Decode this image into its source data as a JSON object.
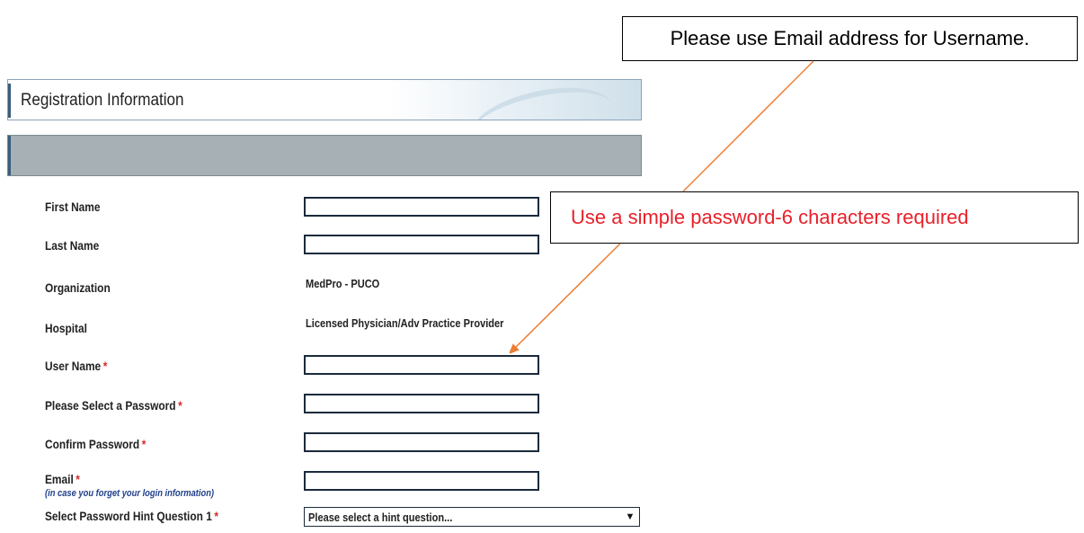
{
  "callouts": {
    "email_note": "Please use Email address for Username.",
    "password_note": "Use a simple password-6 characters required"
  },
  "header": {
    "title": "Registration Information"
  },
  "form": {
    "first_name": {
      "label": "First Name",
      "value": ""
    },
    "last_name": {
      "label": "Last Name",
      "value": ""
    },
    "organization": {
      "label": "Organization",
      "value": "MedPro - PUCO"
    },
    "hospital": {
      "label": "Hospital",
      "value": "Licensed Physician/Adv Practice Provider"
    },
    "user_name": {
      "label": "User Name",
      "value": ""
    },
    "password": {
      "label": "Please Select a Password",
      "value": ""
    },
    "confirm_password": {
      "label": "Confirm Password",
      "value": ""
    },
    "email": {
      "label": "Email",
      "note": "(in case you forget your login information)",
      "value": ""
    },
    "hint_question_1": {
      "label": "Select Password Hint Question 1",
      "selected": "Please select a hint question..."
    },
    "required_marker": "*"
  },
  "colors": {
    "arrow": "#ed7d31",
    "callout_red": "#e8202a",
    "required": "#d62b2b",
    "bar_gray": "#a7b0b4"
  }
}
